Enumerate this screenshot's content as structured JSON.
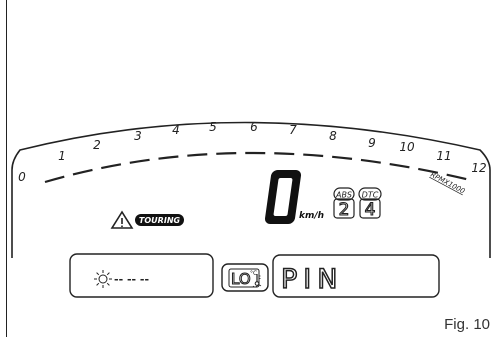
{
  "tachometer": {
    "scale_labels": [
      "0",
      "1",
      "2",
      "3",
      "4",
      "5",
      "6",
      "7",
      "8",
      "9",
      "10",
      "11",
      "12"
    ],
    "unit_label": "RPMX1000"
  },
  "warning": {
    "icon": "warning-triangle-icon",
    "mode_badge": "TOURING"
  },
  "speed": {
    "value": "0",
    "unit": "km/h"
  },
  "abs": {
    "label": "ABS",
    "level": "2"
  },
  "dtc": {
    "label": "DTC",
    "level": "4"
  },
  "left_display": {
    "icon": "blinking-light-icon",
    "dashes": "-- -- --"
  },
  "temperature": {
    "value": "LO",
    "unit": "°C",
    "icon": "thermometer-icon"
  },
  "main_display": {
    "text": "PIN"
  },
  "caption": "Fig. 10"
}
